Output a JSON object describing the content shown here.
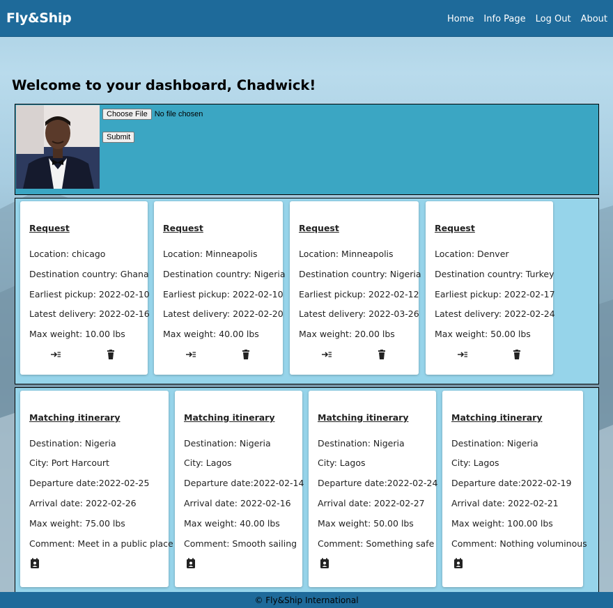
{
  "nav": {
    "brand": "Fly&Ship",
    "links": [
      "Home",
      "Info Page",
      "Log Out",
      "About"
    ]
  },
  "welcome": "Welcome to your dashboard, Chadwick!",
  "upload": {
    "choose_label": "Choose File",
    "file_status": "No file chosen",
    "submit_label": "Submit"
  },
  "requests": [
    {
      "title": "Request",
      "location": "Location: chicago",
      "destination": "Destination country: Ghana",
      "pickup": "Earliest pickup: 2022-02-10",
      "delivery": "Latest delivery: 2022-02-16",
      "weight": "Max weight: 10.00 lbs"
    },
    {
      "title": "Request",
      "location": "Location: Minneapolis",
      "destination": "Destination country: Nigeria",
      "pickup": "Earliest pickup: 2022-02-10",
      "delivery": "Latest delivery: 2022-02-20",
      "weight": "Max weight: 40.00 lbs"
    },
    {
      "title": "Request",
      "location": "Location: Minneapolis",
      "destination": "Destination country: Nigeria",
      "pickup": "Earliest pickup: 2022-02-12",
      "delivery": "Latest delivery: 2022-03-26",
      "weight": "Max weight: 20.00 lbs"
    },
    {
      "title": "Request",
      "location": "Location: Denver",
      "destination": "Destination country: Turkey",
      "pickup": "Earliest pickup: 2022-02-17",
      "delivery": "Latest delivery: 2022-02-24",
      "weight": "Max weight: 50.00 lbs"
    }
  ],
  "itineraries": [
    {
      "title": "Matching itinerary",
      "destination": "Destination: Nigeria",
      "city": "City: Port Harcourt",
      "departure": "Departure date:2022-02-25",
      "arrival": "Arrival date: 2022-02-26",
      "weight": "Max weight: 75.00 lbs",
      "comment": "Comment: Meet in a public place"
    },
    {
      "title": "Matching itinerary",
      "destination": "Destination: Nigeria",
      "city": "City: Lagos",
      "departure": "Departure date:2022-02-14",
      "arrival": "Arrival date: 2022-02-16",
      "weight": "Max weight: 40.00 lbs",
      "comment": "Comment: Smooth sailing"
    },
    {
      "title": "Matching itinerary",
      "destination": "Destination: Nigeria",
      "city": "City: Lagos",
      "departure": "Departure date:2022-02-24",
      "arrival": "Arrival date: 2022-02-27",
      "weight": "Max weight: 50.00 lbs",
      "comment": "Comment: Something safe"
    },
    {
      "title": "Matching itinerary",
      "destination": "Destination: Nigeria",
      "city": "City: Lagos",
      "departure": "Departure date:2022-02-19",
      "arrival": "Arrival date: 2022-02-21",
      "weight": "Max weight: 100.00 lbs",
      "comment": "Comment: Nothing voluminous"
    }
  ],
  "footer": "© Fly&Ship International",
  "icons": {
    "match": "arrow-right-list-icon",
    "delete": "trash-icon",
    "contact": "contact-book-icon"
  },
  "colors": {
    "navbar": "#1e6a9a",
    "profile_box": "#3ba6c3",
    "card_area": "#96d4ea"
  }
}
